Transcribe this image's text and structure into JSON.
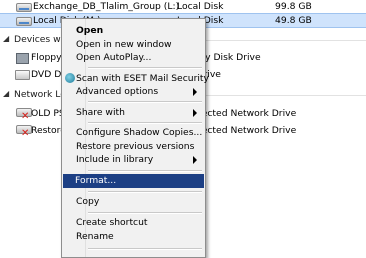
{
  "drives": [
    {
      "name": "Exchange_DB_Tlalim_Group (L:)",
      "type": "Local Disk",
      "size": "99.8 GB"
    },
    {
      "name": "Local Disk (M:)",
      "type": "Local Disk",
      "size": "49.8 GB"
    }
  ],
  "groups": {
    "removable": "Devices with Removable Storage",
    "network": "Network Location"
  },
  "removable_items": [
    {
      "name": "Floppy Disk Drive (A:)",
      "type": "Floppy Disk Drive"
    },
    {
      "name": "DVD Drive (D:)",
      "type": "CD Drive"
    }
  ],
  "network_items": [
    {
      "name": "OLD PST",
      "status": "Disconnected Network Drive"
    },
    {
      "name": "Restore",
      "status": "Disconnected Network Drive"
    }
  ],
  "context_menu": {
    "items": [
      {
        "label": "Open",
        "bold": true
      },
      {
        "label": "Open in new window"
      },
      {
        "label": "Open AutoPlay..."
      },
      {
        "label": "Scan with ESET Mail Security",
        "icon": "eset-icon"
      },
      {
        "label": "Advanced options",
        "submenu": true
      },
      {
        "label": "Share with",
        "submenu": true
      },
      {
        "label": "Configure Shadow Copies..."
      },
      {
        "label": "Restore previous versions"
      },
      {
        "label": "Include in library",
        "submenu": true
      },
      {
        "label": "Format...",
        "highlighted": true
      },
      {
        "label": "Copy"
      },
      {
        "label": "Create shortcut"
      },
      {
        "label": "Rename"
      }
    ]
  },
  "colors": {
    "highlight": "#1c3f84",
    "selection": "#cfe3fc"
  }
}
